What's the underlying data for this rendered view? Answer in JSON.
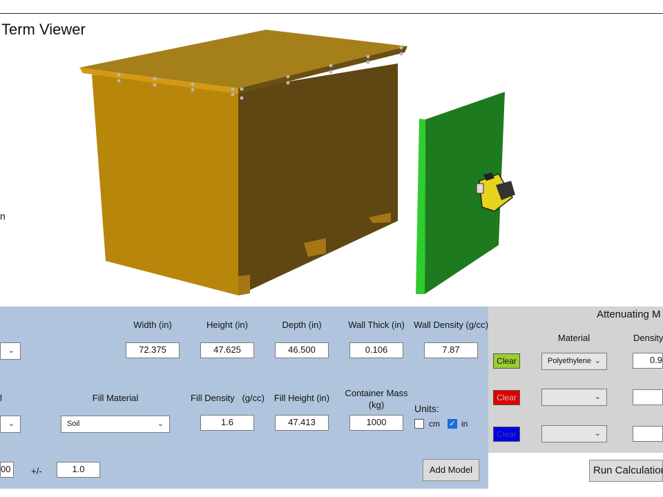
{
  "window": {
    "title": "Term Viewer",
    "side_label": "n"
  },
  "colors": {
    "crate": "#b8860b",
    "panel": "#1e9a1e",
    "main_panel": "#b0c4de",
    "right_panel": "#d3d3d3"
  },
  "dimensions": {
    "headers": {
      "width": "Width (in)",
      "height": "Height (in)",
      "depth": "Depth (in)",
      "wall_thick": "Wall Thick (in)",
      "wall_density": "Wall Density (g/cc)"
    },
    "values": {
      "width": "72.375",
      "height": "47.625",
      "depth": "46.500",
      "wall_thick": "0.106",
      "wall_density": "7.87"
    }
  },
  "fill": {
    "left_label": "l",
    "headers": {
      "material": "Fill Material",
      "density": "Fill Density   (g/cc)",
      "height": "Fill Height (in)",
      "mass": "Container Mass (kg)"
    },
    "values": {
      "material": "Soil",
      "density": "1.6",
      "height": "47.413",
      "mass": "1000"
    }
  },
  "units": {
    "label": "Units:",
    "cm": "cm",
    "in": "in",
    "cm_checked": false,
    "in_checked": true
  },
  "bottom": {
    "left_value": "00",
    "plusminus": "+/-",
    "tolerance": "1.0",
    "add_model": "Add Model"
  },
  "attenuating": {
    "title": "Attenuating M",
    "col_material": "Material",
    "col_density": "Density",
    "rows": [
      {
        "clear": "Clear",
        "color": "#9acd32",
        "material": "Polyethylene",
        "density": "0.9"
      },
      {
        "clear": "Clear",
        "color": "#e00000",
        "material": "",
        "density": ""
      },
      {
        "clear": "Clear",
        "color": "#0000e0",
        "material": "",
        "density": ""
      }
    ],
    "run": "Run Calculation"
  },
  "chevron": "⌄"
}
